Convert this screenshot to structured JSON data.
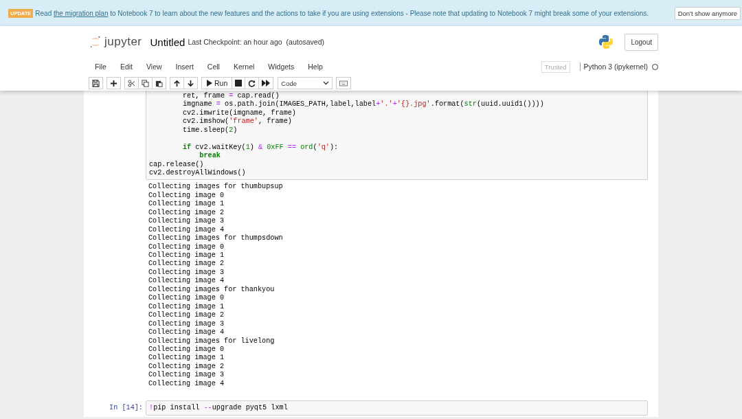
{
  "banner": {
    "badge": "UPDATE",
    "text_before": "Read",
    "link": "the migration plan",
    "text_after": "to Notebook 7 to learn about the new features and the actions to take if you are using extensions - Please note that updating to Notebook 7 might break some of your extensions.",
    "dismiss": "Don't show anymore"
  },
  "header": {
    "logo_text": "jupyter",
    "notebook_name": "Untitled",
    "checkpoint": "Last Checkpoint: an hour ago",
    "autosave": "(autosaved)",
    "logout": "Logout"
  },
  "menu": [
    "File",
    "Edit",
    "View",
    "Insert",
    "Cell",
    "Kernel",
    "Widgets",
    "Help"
  ],
  "trusted": "Trusted",
  "kernel": {
    "name": "Python 3 (ipykernel)",
    "busy": false
  },
  "toolbar": {
    "run": "Run",
    "cell_type": "Code"
  },
  "cells": [
    {
      "code": [
        {
          "kind": "code",
          "tokens": [
            {
              "kind": "plain",
              "text": "        ret, frame "
            },
            {
              "kind": "op",
              "text": "="
            },
            {
              "kind": "plain",
              "text": " cap.read()"
            }
          ]
        },
        {
          "kind": "code",
          "tokens": [
            {
              "kind": "plain",
              "text": "        imgname "
            },
            {
              "kind": "op",
              "text": "="
            },
            {
              "kind": "plain",
              "text": " os.path.join(IMAGES_PATH,label,label"
            },
            {
              "kind": "op",
              "text": "+"
            },
            {
              "kind": "str",
              "text": "'.'"
            },
            {
              "kind": "op",
              "text": "+"
            },
            {
              "kind": "str",
              "text": "'{}.jpg'"
            },
            {
              "kind": "plain",
              "text": ".format("
            },
            {
              "kind": "builtin",
              "text": "str"
            },
            {
              "kind": "plain",
              "text": "(uuid.uuid1())))"
            }
          ]
        },
        {
          "kind": "code",
          "tokens": [
            {
              "kind": "plain",
              "text": "        cv2.imwrite(imgname, frame)"
            }
          ]
        },
        {
          "kind": "code",
          "tokens": [
            {
              "kind": "plain",
              "text": "        cv2.imshow("
            },
            {
              "kind": "str",
              "text": "'frame'"
            },
            {
              "kind": "plain",
              "text": ", frame)"
            }
          ]
        },
        {
          "kind": "code",
          "tokens": [
            {
              "kind": "plain",
              "text": "        time.sleep("
            },
            {
              "kind": "num",
              "text": "2"
            },
            {
              "kind": "plain",
              "text": ")"
            }
          ]
        },
        {
          "kind": "blank"
        },
        {
          "kind": "code",
          "tokens": [
            {
              "kind": "kw",
              "text": "        if"
            },
            {
              "kind": "plain",
              "text": " cv2.waitKey("
            },
            {
              "kind": "num",
              "text": "1"
            },
            {
              "kind": "plain",
              "text": ") "
            },
            {
              "kind": "op",
              "text": "&"
            },
            {
              "kind": "num",
              "text": " 0xFF"
            },
            {
              "kind": "op",
              "text": " =="
            },
            {
              "kind": "builtin",
              "text": " ord"
            },
            {
              "kind": "plain",
              "text": "("
            },
            {
              "kind": "str",
              "text": "'q'"
            },
            {
              "kind": "plain",
              "text": "):"
            }
          ]
        },
        {
          "kind": "code",
          "tokens": [
            {
              "kind": "kw",
              "text": "            break"
            }
          ]
        },
        {
          "kind": "code",
          "tokens": [
            {
              "kind": "plain",
              "text": "cap.release()"
            }
          ]
        },
        {
          "kind": "code",
          "tokens": [
            {
              "kind": "plain",
              "text": "cv2.destroyAllWindows()"
            }
          ]
        }
      ],
      "output": [
        "Collecting images for thumbupsup",
        "Collecting image 0",
        "Collecting image 1",
        "Collecting image 2",
        "Collecting image 3",
        "Collecting image 4",
        "Collecting images for thumpsdown",
        "Collecting image 0",
        "Collecting image 1",
        "Collecting image 2",
        "Collecting image 3",
        "Collecting image 4",
        "Collecting images for thankyou",
        "Collecting image 0",
        "Collecting image 1",
        "Collecting image 2",
        "Collecting image 3",
        "Collecting image 4",
        "Collecting images for livelong",
        "Collecting image 0",
        "Collecting image 1",
        "Collecting image 2",
        "Collecting image 3",
        "Collecting image 4"
      ]
    },
    {
      "prompt": "In [14]:",
      "code": [
        {
          "kind": "code",
          "tokens": [
            {
              "kind": "op",
              "text": "!"
            },
            {
              "kind": "plain",
              "text": "pip install "
            },
            {
              "kind": "op",
              "text": "--"
            },
            {
              "kind": "plain",
              "text": "upgrade pyqt5 lxml"
            }
          ]
        }
      ]
    }
  ]
}
